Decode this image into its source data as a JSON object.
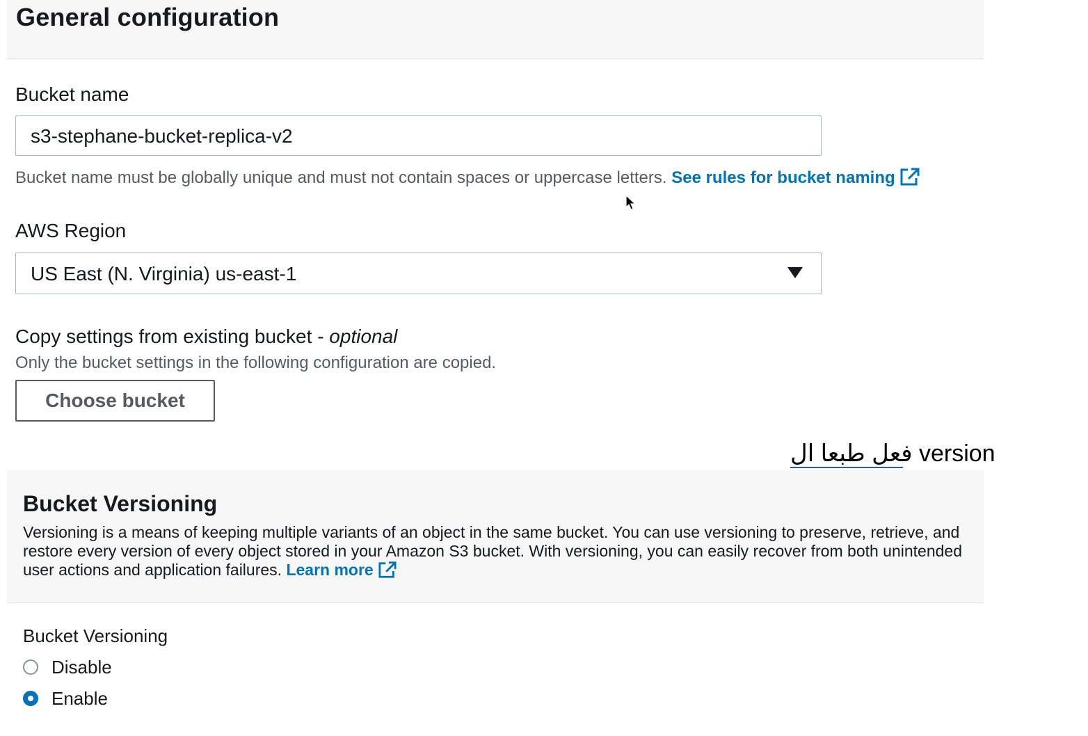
{
  "general_configuration": {
    "title": "General configuration",
    "bucket_name": {
      "label": "Bucket name",
      "value": "s3-stephane-bucket-replica-v2",
      "hint": "Bucket name must be globally unique and must not contain spaces or uppercase letters.",
      "rules_link": "See rules for bucket naming"
    },
    "region": {
      "label": "AWS Region",
      "selected": "US East (N. Virginia) us-east-1"
    },
    "copy_settings": {
      "label": "Copy settings from existing bucket - ",
      "label_optional": "optional",
      "hint": "Only the bucket settings in the following configuration are copied.",
      "button": "Choose bucket"
    }
  },
  "annotation": {
    "text": "فعل طبعا ال  version"
  },
  "bucket_versioning": {
    "title": "Bucket Versioning",
    "description": "Versioning is a means of keeping multiple variants of an object in the same bucket. You can use versioning to preserve, retrieve, and restore every version of every object stored in your Amazon S3 bucket. With versioning, you can easily recover from both unintended user actions and application failures.",
    "learn_more": "Learn more",
    "field_label": "Bucket Versioning",
    "options": [
      {
        "label": "Disable",
        "checked": false
      },
      {
        "label": "Enable",
        "checked": true
      }
    ]
  },
  "colors": {
    "link": "#0073bb",
    "panel_bg": "#f6f6f6",
    "radio_selected": "#0073bb"
  },
  "icons": [
    "external-link-icon",
    "dropdown-caret-icon",
    "mouse-cursor-icon"
  ]
}
